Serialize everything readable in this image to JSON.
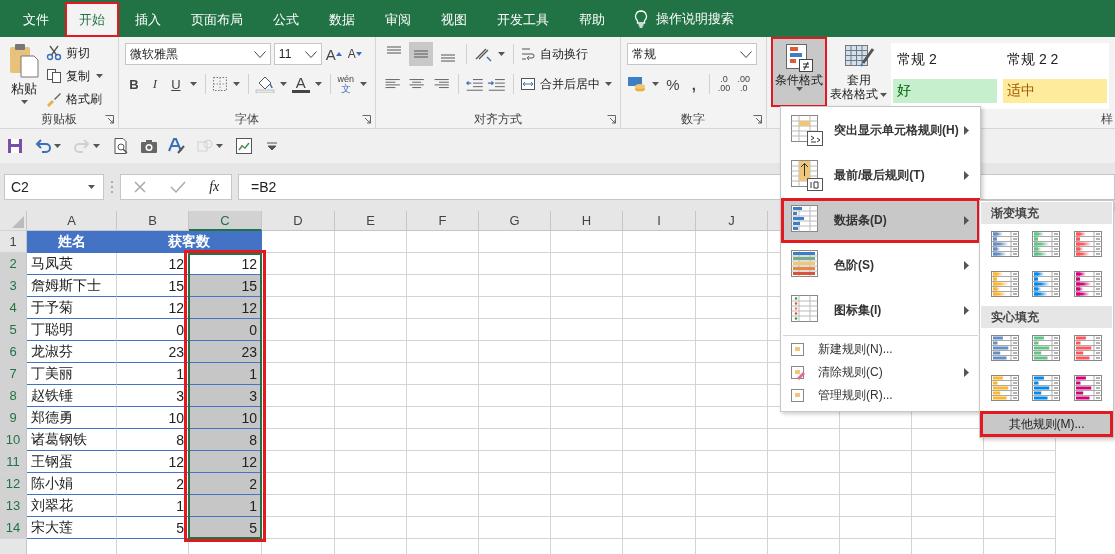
{
  "ribbon_tabs": [
    {
      "label": "文件",
      "selected": false,
      "annotated": false
    },
    {
      "label": "开始",
      "selected": true,
      "annotated": true
    },
    {
      "label": "插入",
      "selected": false,
      "annotated": false
    },
    {
      "label": "页面布局",
      "selected": false,
      "annotated": false
    },
    {
      "label": "公式",
      "selected": false,
      "annotated": false
    },
    {
      "label": "数据",
      "selected": false,
      "annotated": false
    },
    {
      "label": "审阅",
      "selected": false,
      "annotated": false
    },
    {
      "label": "视图",
      "selected": false,
      "annotated": false
    },
    {
      "label": "开发工具",
      "selected": false,
      "annotated": false
    },
    {
      "label": "帮助",
      "selected": false,
      "annotated": false
    }
  ],
  "tell_me": {
    "label": "操作说明搜索"
  },
  "clipboard": {
    "title": "剪贴板",
    "paste": "粘贴",
    "cut": "剪切",
    "copy": "复制",
    "format_painter": "格式刷"
  },
  "font": {
    "title": "字体",
    "name": "微软雅黑",
    "size": "11",
    "grow": "A",
    "shrink": "A",
    "bold": "B",
    "italic": "I",
    "underline": "U",
    "font_color": "A",
    "phonetic_top": "wén",
    "phonetic_bottom": "文"
  },
  "alignment": {
    "title": "对齐方式",
    "wrap_text": "自动换行",
    "merge_center": "合并后居中",
    "vertical_align": [
      {
        "selected": false
      },
      {
        "selected": true
      },
      {
        "selected": false
      }
    ]
  },
  "number": {
    "title": "数字",
    "format": "常规",
    "percent": "%",
    "comma": ",",
    "increase_decimal": [
      ".0",
      ".00"
    ],
    "decrease_decimal": [
      ".00",
      ".0"
    ]
  },
  "styles": {
    "title": "样",
    "conditional_formatting": {
      "label": "条件格式",
      "selected": true,
      "annotated": true
    },
    "format_as_table": [
      "套用",
      "表格格式"
    ],
    "gallery": [
      {
        "label": "常规 2",
        "kind": "plain"
      },
      {
        "label": "常规 2 2",
        "kind": "plain"
      },
      {
        "label": "好",
        "kind": "good"
      },
      {
        "label": "适中",
        "kind": "neutral"
      }
    ]
  },
  "quick_access": [
    {
      "kind": "save",
      "dropdown": false,
      "disabled": false
    },
    {
      "kind": "undo",
      "dropdown": true,
      "disabled": false
    },
    {
      "kind": "redo",
      "dropdown": true,
      "disabled": true
    },
    {
      "kind": "preview",
      "dropdown": false,
      "disabled": false
    },
    {
      "kind": "camera",
      "dropdown": false,
      "disabled": false
    },
    {
      "kind": "style",
      "dropdown": false,
      "disabled": false
    },
    {
      "kind": "shapes",
      "dropdown": true,
      "disabled": true
    },
    {
      "kind": "chart",
      "dropdown": false,
      "disabled": false
    },
    {
      "kind": "customize",
      "dropdown": false,
      "disabled": false
    }
  ],
  "formula_bar": {
    "name_box": "C2",
    "function_label": "fx",
    "formula": "=B2"
  },
  "sheet": {
    "columns": [
      {
        "label": "A",
        "selected": false
      },
      {
        "label": "B",
        "selected": false
      },
      {
        "label": "C",
        "selected": true
      },
      {
        "label": "D",
        "selected": false
      },
      {
        "label": "E",
        "selected": false
      },
      {
        "label": "F",
        "selected": false
      },
      {
        "label": "G",
        "selected": false
      },
      {
        "label": "H",
        "selected": false
      },
      {
        "label": "I",
        "selected": false
      },
      {
        "label": "J",
        "selected": false
      }
    ],
    "header": {
      "number": "1",
      "name": "姓名",
      "count": "获客数"
    },
    "range_annotated": true,
    "rows": [
      {
        "number": "2",
        "name": "马凤英",
        "count": "12",
        "result": "12",
        "selected": true,
        "active": true
      },
      {
        "number": "3",
        "name": "詹姆斯下士",
        "count": "15",
        "result": "15",
        "selected": true,
        "active": false
      },
      {
        "number": "4",
        "name": "于予菊",
        "count": "12",
        "result": "12",
        "selected": true,
        "active": false
      },
      {
        "number": "5",
        "name": "丁聪明",
        "count": "0",
        "result": "0",
        "selected": true,
        "active": false
      },
      {
        "number": "6",
        "name": "龙淑芬",
        "count": "23",
        "result": "23",
        "selected": true,
        "active": false
      },
      {
        "number": "7",
        "name": "丁美丽",
        "count": "1",
        "result": "1",
        "selected": true,
        "active": false
      },
      {
        "number": "8",
        "name": "赵铁锤",
        "count": "3",
        "result": "3",
        "selected": true,
        "active": false
      },
      {
        "number": "9",
        "name": "郑德勇",
        "count": "10",
        "result": "10",
        "selected": true,
        "active": false
      },
      {
        "number": "10",
        "name": "诸葛钢铁",
        "count": "8",
        "result": "8",
        "selected": true,
        "active": false
      },
      {
        "number": "11",
        "name": "王钢蛋",
        "count": "12",
        "result": "12",
        "selected": true,
        "active": false
      },
      {
        "number": "12",
        "name": "陈小娟",
        "count": "2",
        "result": "2",
        "selected": true,
        "active": false
      },
      {
        "number": "13",
        "name": "刘翠花",
        "count": "1",
        "result": "1",
        "selected": true,
        "active": false
      },
      {
        "number": "14",
        "name": "宋大莲",
        "count": "5",
        "result": "5",
        "selected": true,
        "active": false
      }
    ]
  },
  "cf_menu": [
    {
      "label": "突出显示单元格规则(H)",
      "kind": "large",
      "submenu": true,
      "selected": false,
      "annotated": false
    },
    {
      "label": "最前/最后规则(T)",
      "kind": "large",
      "submenu": true,
      "selected": false,
      "annotated": false
    },
    {
      "label": "数据条(D)",
      "kind": "large",
      "submenu": true,
      "selected": true,
      "annotated": true
    },
    {
      "label": "色阶(S)",
      "kind": "large",
      "submenu": true,
      "selected": false,
      "annotated": false
    },
    {
      "label": "图标集(I)",
      "kind": "large",
      "submenu": true,
      "selected": false,
      "annotated": false
    },
    {
      "label": "新建规则(N)...",
      "kind": "small",
      "submenu": false,
      "selected": false,
      "annotated": false
    },
    {
      "label": "清除规则(C)",
      "kind": "small",
      "submenu": true,
      "selected": false,
      "annotated": false
    },
    {
      "label": "管理规则(R)...",
      "kind": "small",
      "submenu": false,
      "selected": false,
      "annotated": false
    }
  ],
  "data_bar_menu": {
    "sections": [
      {
        "title": "渐变填充",
        "kind": "gradient",
        "styles": [
          {
            "color": "#638ec6"
          },
          {
            "color": "#63c384"
          },
          {
            "color": "#ff555a"
          },
          {
            "color": "#ffb628"
          },
          {
            "color": "#008aef"
          },
          {
            "color": "#d6007b"
          }
        ]
      },
      {
        "title": "实心填充",
        "kind": "solid",
        "styles": [
          {
            "color": "#638ec6"
          },
          {
            "color": "#63c384"
          },
          {
            "color": "#ff555a"
          },
          {
            "color": "#ffb628"
          },
          {
            "color": "#008aef"
          },
          {
            "color": "#d6007b"
          }
        ]
      }
    ],
    "more_rules": {
      "label": "其他规则(M)...",
      "annotated": true
    }
  }
}
